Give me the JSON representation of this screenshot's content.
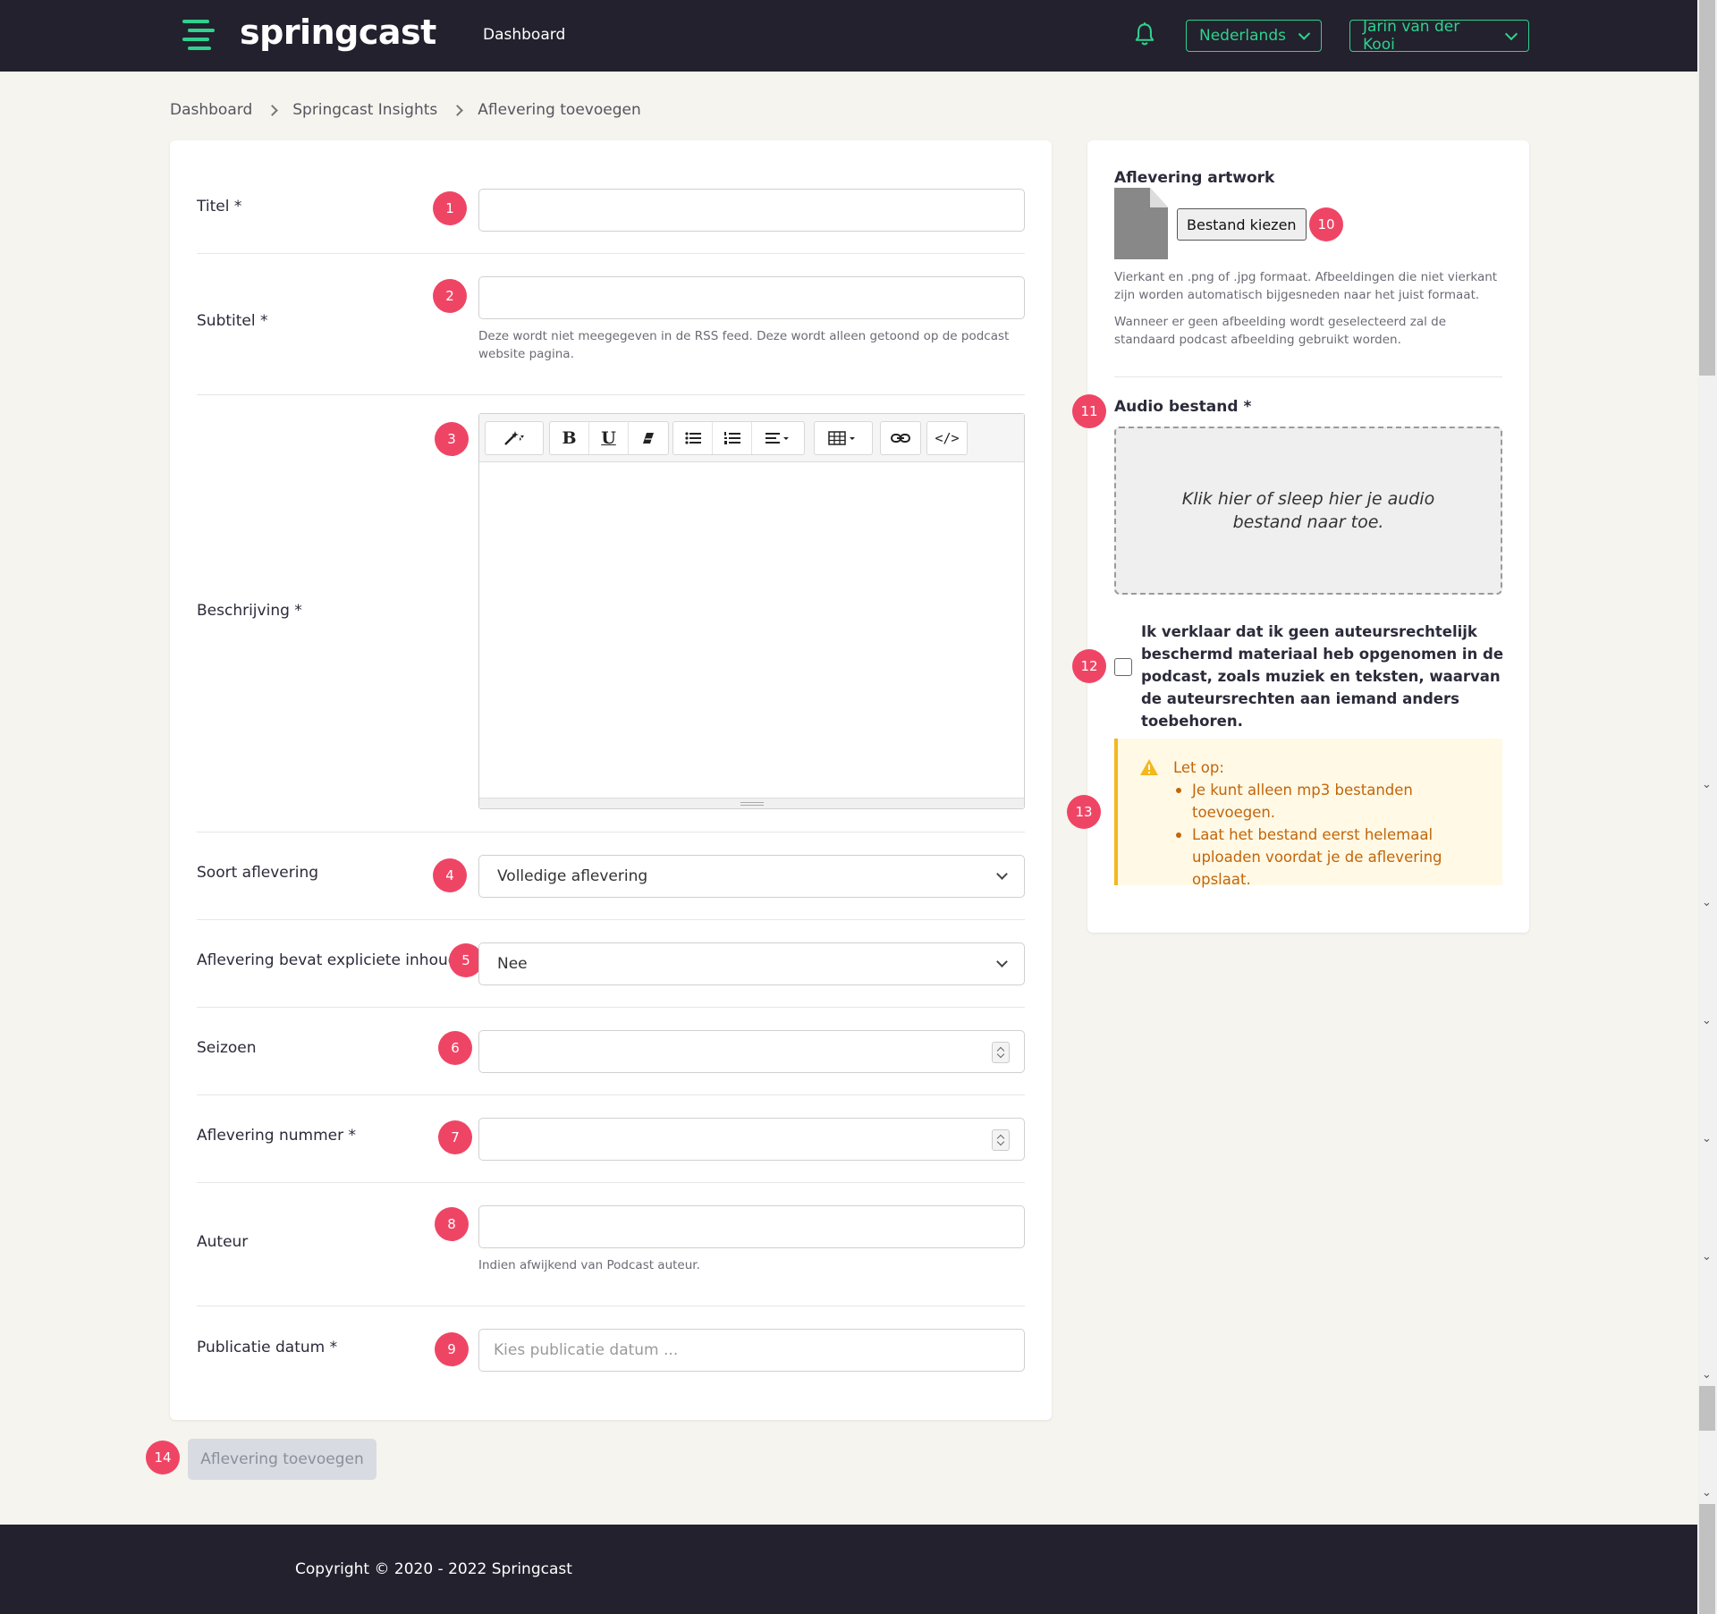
{
  "navbar": {
    "brand": "springcast",
    "link": "Dashboard",
    "language": "Nederlands",
    "user": "Jarin van der Kooi",
    "accent_color": "#2ed28e",
    "bell_icon": "bell-icon"
  },
  "breadcrumb": [
    "Dashboard",
    "Springcast Insights",
    "Aflevering toevoegen"
  ],
  "form": {
    "titel": {
      "label": "Titel *",
      "badge": "1",
      "value": ""
    },
    "subtitel": {
      "label": "Subtitel *",
      "badge": "2",
      "value": "",
      "help": "Deze wordt niet meegegeven in de RSS feed. Deze wordt alleen getoond op de podcast website pagina."
    },
    "beschrijving": {
      "label": "Beschrijving *",
      "badge": "3"
    },
    "soort": {
      "label": "Soort aflevering",
      "badge": "4",
      "value": "Volledige aflevering"
    },
    "expliciet": {
      "label": "Aflevering bevat expliciete inhoud",
      "badge": "5",
      "value": "Nee"
    },
    "seizoen": {
      "label": "Seizoen",
      "badge": "6",
      "value": ""
    },
    "nummer": {
      "label": "Aflevering nummer *",
      "badge": "7",
      "value": ""
    },
    "auteur": {
      "label": "Auteur",
      "badge": "8",
      "value": "",
      "help": "Indien afwijkend van Podcast auteur."
    },
    "datum": {
      "label": "Publicatie datum *",
      "badge": "9",
      "placeholder": "Kies publicatie datum ..."
    }
  },
  "editor_toolbar": {
    "style_icon": "magic-wand-icon",
    "bold": "B",
    "underline": "U",
    "eraser_icon": "eraser-icon",
    "ul_icon": "unordered-list-icon",
    "ol_icon": "ordered-list-icon",
    "align_icon": "align-icon",
    "table_icon": "table-icon",
    "link_icon": "link-icon",
    "code": "</>"
  },
  "submit": {
    "label": "Aflevering toevoegen",
    "badge": "14"
  },
  "right": {
    "artwork_heading": "Aflevering artwork",
    "file_button": "Bestand kiezen",
    "file_badge": "10",
    "artwork_help_1": "Vierkant en .png of .jpg formaat. Afbeeldingen die niet vierkant zijn worden automatisch bijgesneden naar het juist formaat.",
    "artwork_help_2": "Wanneer er geen afbeelding wordt geselecteerd zal de standaard podcast afbeelding gebruikt worden.",
    "audio_heading": "Audio bestand *",
    "audio_badge": "11",
    "dropzone_text": "Klik hier of sleep hier je audio bestand naar toe.",
    "checkbox_badge": "12",
    "checkbox_label": "Ik verklaar dat ik geen auteursrechtelijk beschermd materiaal heb opgenomen in de podcast, zoals muziek en teksten, waarvan de auteursrechten aan iemand anders toebehoren.",
    "warning_badge": "13",
    "warning_title": "Let op:",
    "warning_items": [
      "Je kunt alleen mp3 bestanden toevoegen.",
      "Laat het bestand eerst helemaal uploaden voordat je de aflevering opslaat."
    ]
  },
  "footer": {
    "copyright": "Copyright © 2020 - 2022 Springcast"
  }
}
